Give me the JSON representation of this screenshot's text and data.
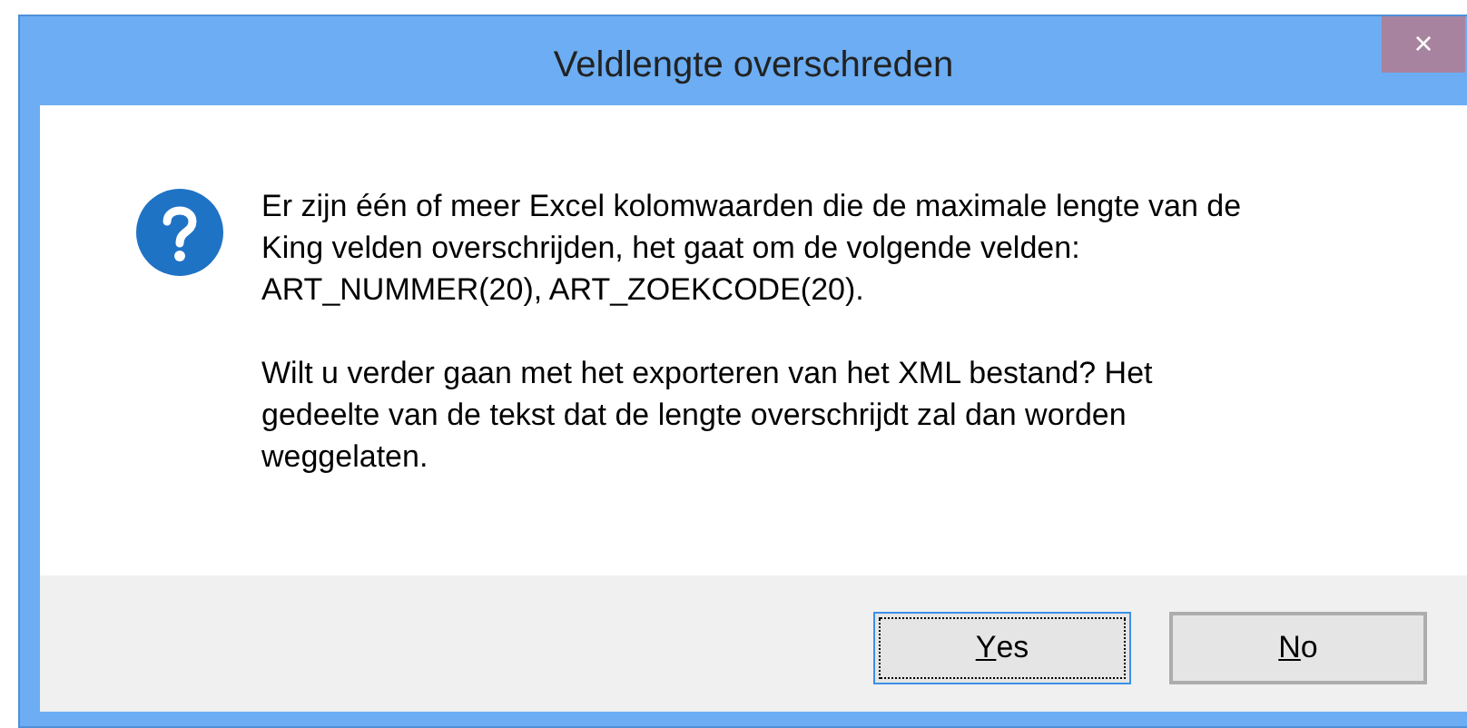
{
  "window": {
    "title": "Veldlengte overschreden",
    "close": "×"
  },
  "message": {
    "paragraphs": [
      {
        "lines": [
          "Er zijn één of meer Excel kolomwaarden die de maximale lengte van de",
          "King velden overschrijden, het gaat om de volgende velden:",
          "ART_NUMMER(20), ART_ZOEKCODE(20)."
        ]
      },
      {
        "lines": [
          "Wilt u verder gaan met het exporteren van het XML bestand? Het",
          "gedeelte van de tekst dat de lengte overschrijdt zal dan worden",
          "weggelaten."
        ]
      }
    ]
  },
  "buttons": [
    {
      "label": "Yes",
      "mnemonic_underlined": true,
      "focused": true
    },
    {
      "label": "No",
      "mnemonic_underlined": true,
      "focused": false
    }
  ]
}
